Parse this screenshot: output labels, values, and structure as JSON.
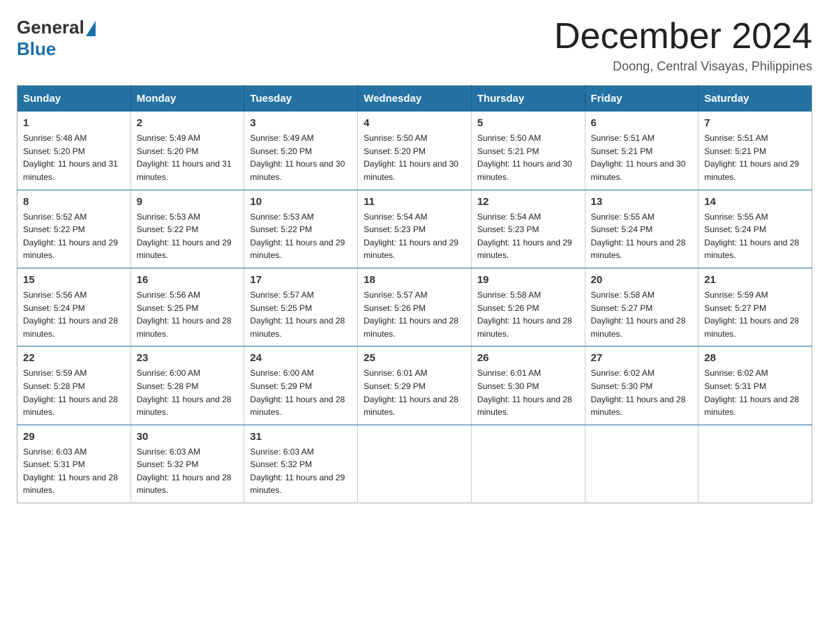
{
  "header": {
    "logo_general": "General",
    "logo_blue": "Blue",
    "month_title": "December 2024",
    "location": "Doong, Central Visayas, Philippines"
  },
  "weekdays": [
    "Sunday",
    "Monday",
    "Tuesday",
    "Wednesday",
    "Thursday",
    "Friday",
    "Saturday"
  ],
  "weeks": [
    [
      {
        "day": "1",
        "sunrise": "5:48 AM",
        "sunset": "5:20 PM",
        "daylight": "11 hours and 31 minutes."
      },
      {
        "day": "2",
        "sunrise": "5:49 AM",
        "sunset": "5:20 PM",
        "daylight": "11 hours and 31 minutes."
      },
      {
        "day": "3",
        "sunrise": "5:49 AM",
        "sunset": "5:20 PM",
        "daylight": "11 hours and 30 minutes."
      },
      {
        "day": "4",
        "sunrise": "5:50 AM",
        "sunset": "5:20 PM",
        "daylight": "11 hours and 30 minutes."
      },
      {
        "day": "5",
        "sunrise": "5:50 AM",
        "sunset": "5:21 PM",
        "daylight": "11 hours and 30 minutes."
      },
      {
        "day": "6",
        "sunrise": "5:51 AM",
        "sunset": "5:21 PM",
        "daylight": "11 hours and 30 minutes."
      },
      {
        "day": "7",
        "sunrise": "5:51 AM",
        "sunset": "5:21 PM",
        "daylight": "11 hours and 29 minutes."
      }
    ],
    [
      {
        "day": "8",
        "sunrise": "5:52 AM",
        "sunset": "5:22 PM",
        "daylight": "11 hours and 29 minutes."
      },
      {
        "day": "9",
        "sunrise": "5:53 AM",
        "sunset": "5:22 PM",
        "daylight": "11 hours and 29 minutes."
      },
      {
        "day": "10",
        "sunrise": "5:53 AM",
        "sunset": "5:22 PM",
        "daylight": "11 hours and 29 minutes."
      },
      {
        "day": "11",
        "sunrise": "5:54 AM",
        "sunset": "5:23 PM",
        "daylight": "11 hours and 29 minutes."
      },
      {
        "day": "12",
        "sunrise": "5:54 AM",
        "sunset": "5:23 PM",
        "daylight": "11 hours and 29 minutes."
      },
      {
        "day": "13",
        "sunrise": "5:55 AM",
        "sunset": "5:24 PM",
        "daylight": "11 hours and 28 minutes."
      },
      {
        "day": "14",
        "sunrise": "5:55 AM",
        "sunset": "5:24 PM",
        "daylight": "11 hours and 28 minutes."
      }
    ],
    [
      {
        "day": "15",
        "sunrise": "5:56 AM",
        "sunset": "5:24 PM",
        "daylight": "11 hours and 28 minutes."
      },
      {
        "day": "16",
        "sunrise": "5:56 AM",
        "sunset": "5:25 PM",
        "daylight": "11 hours and 28 minutes."
      },
      {
        "day": "17",
        "sunrise": "5:57 AM",
        "sunset": "5:25 PM",
        "daylight": "11 hours and 28 minutes."
      },
      {
        "day": "18",
        "sunrise": "5:57 AM",
        "sunset": "5:26 PM",
        "daylight": "11 hours and 28 minutes."
      },
      {
        "day": "19",
        "sunrise": "5:58 AM",
        "sunset": "5:26 PM",
        "daylight": "11 hours and 28 minutes."
      },
      {
        "day": "20",
        "sunrise": "5:58 AM",
        "sunset": "5:27 PM",
        "daylight": "11 hours and 28 minutes."
      },
      {
        "day": "21",
        "sunrise": "5:59 AM",
        "sunset": "5:27 PM",
        "daylight": "11 hours and 28 minutes."
      }
    ],
    [
      {
        "day": "22",
        "sunrise": "5:59 AM",
        "sunset": "5:28 PM",
        "daylight": "11 hours and 28 minutes."
      },
      {
        "day": "23",
        "sunrise": "6:00 AM",
        "sunset": "5:28 PM",
        "daylight": "11 hours and 28 minutes."
      },
      {
        "day": "24",
        "sunrise": "6:00 AM",
        "sunset": "5:29 PM",
        "daylight": "11 hours and 28 minutes."
      },
      {
        "day": "25",
        "sunrise": "6:01 AM",
        "sunset": "5:29 PM",
        "daylight": "11 hours and 28 minutes."
      },
      {
        "day": "26",
        "sunrise": "6:01 AM",
        "sunset": "5:30 PM",
        "daylight": "11 hours and 28 minutes."
      },
      {
        "day": "27",
        "sunrise": "6:02 AM",
        "sunset": "5:30 PM",
        "daylight": "11 hours and 28 minutes."
      },
      {
        "day": "28",
        "sunrise": "6:02 AM",
        "sunset": "5:31 PM",
        "daylight": "11 hours and 28 minutes."
      }
    ],
    [
      {
        "day": "29",
        "sunrise": "6:03 AM",
        "sunset": "5:31 PM",
        "daylight": "11 hours and 28 minutes."
      },
      {
        "day": "30",
        "sunrise": "6:03 AM",
        "sunset": "5:32 PM",
        "daylight": "11 hours and 28 minutes."
      },
      {
        "day": "31",
        "sunrise": "6:03 AM",
        "sunset": "5:32 PM",
        "daylight": "11 hours and 29 minutes."
      },
      null,
      null,
      null,
      null
    ]
  ]
}
